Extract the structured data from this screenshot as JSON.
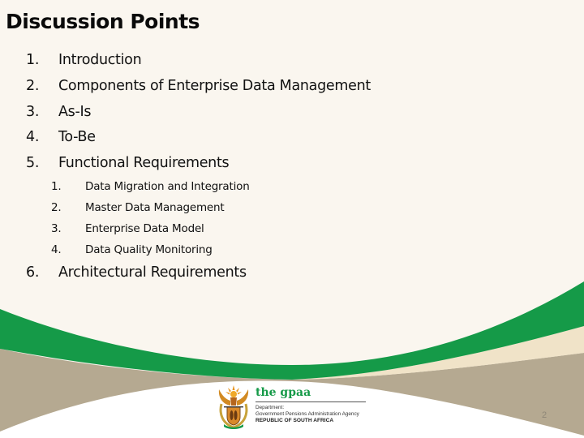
{
  "slide": {
    "title": "Discussion Points",
    "items": [
      {
        "num": "1.",
        "label": "Introduction"
      },
      {
        "num": "2.",
        "label": "Components of Enterprise Data Management"
      },
      {
        "num": "3.",
        "label": "As-Is"
      },
      {
        "num": "4.",
        "label": "To-Be"
      },
      {
        "num": "5.",
        "label": "Functional Requirements"
      }
    ],
    "sub_items": [
      {
        "num": "1.",
        "label": "Data Migration and Integration"
      },
      {
        "num": "2.",
        "label": "Master Data Management"
      },
      {
        "num": "3.",
        "label": "Enterprise Data Model"
      },
      {
        "num": "4.",
        "label": "Data Quality Monitoring"
      }
    ],
    "last_item": {
      "num": "6.",
      "label": "Architectural Requirements"
    },
    "page_number": "2"
  },
  "footer_logo": {
    "crest_icon": "south-africa-coat-of-arms-icon",
    "brand": "the gpaa",
    "department_line": "Department:",
    "agency_line": "Government Pensions Administration Agency",
    "republic_line": "REPUBLIC OF SOUTH AFRICA"
  },
  "colors": {
    "background": "#faf6ef",
    "green_swoosh": "#159a48",
    "taupe_swoosh": "#b5a991",
    "cream_swoosh": "#f0e3c8",
    "brand_green": "#159a48"
  }
}
